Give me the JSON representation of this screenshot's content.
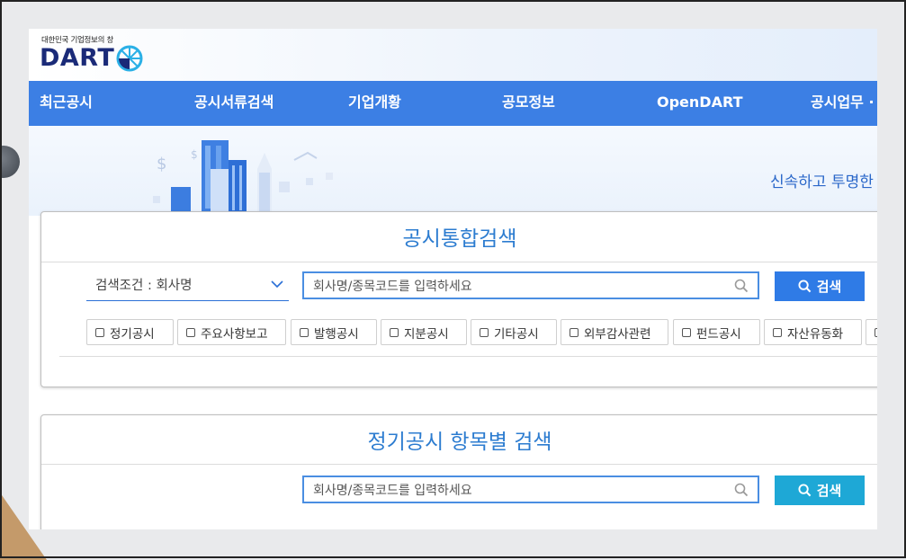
{
  "logo": {
    "tagline": "대한민국 기업정보의 창",
    "word": "DART"
  },
  "nav": {
    "items": [
      {
        "label": "최근공시"
      },
      {
        "label": "공시서류검색"
      },
      {
        "label": "기업개황"
      },
      {
        "label": "공모정보"
      },
      {
        "label": "OpenDART"
      },
      {
        "label": "공시업무 ·"
      }
    ]
  },
  "hero": {
    "slogan": "신속하고 투명한"
  },
  "integrated_search": {
    "title": "공시통합검색",
    "condition_label": "검색조건 : 회사명",
    "input_placeholder": "회사명/종목코드를 입력하세요",
    "button_label": "검색",
    "chips": [
      {
        "label": "정기공시"
      },
      {
        "label": "주요사항보고"
      },
      {
        "label": "발행공시"
      },
      {
        "label": "지분공시"
      },
      {
        "label": "기타공시"
      },
      {
        "label": "외부감사관련"
      },
      {
        "label": "펀드공시"
      },
      {
        "label": "자산유동화"
      }
    ]
  },
  "periodic_search": {
    "title": "정기공시 항목별 검색",
    "input_placeholder": "회사명/종목코드를 입력하세요",
    "button_label": "검색"
  },
  "colors": {
    "nav": "#3c7fe4",
    "primary_button": "#2f7be6",
    "secondary_button": "#1ea8d6",
    "title": "#2c7cd0",
    "logo": "#1a2a78"
  }
}
